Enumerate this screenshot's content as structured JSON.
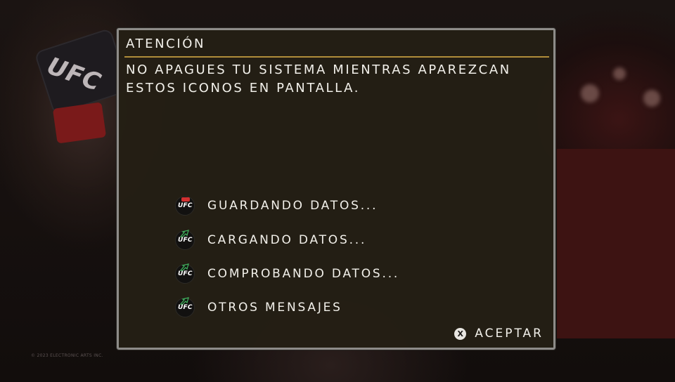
{
  "background": {
    "logo_text": "UFC",
    "copyright": "© 2023 ELECTRONIC ARTS INC."
  },
  "dialog": {
    "title": "ATENCIÓN",
    "message": "NO APAGUES TU SISTEMA MIENTRAS APAREZCAN ESTOS ICONOS EN PANTALLA.",
    "icons": [
      {
        "icon": "ufc-saving-icon",
        "badge_text": "UFC",
        "label": "GUARDANDO DATOS..."
      },
      {
        "icon": "ufc-loading-icon",
        "badge_text": "UFC",
        "label": "CARGANDO DATOS..."
      },
      {
        "icon": "ufc-checking-icon",
        "badge_text": "UFC",
        "label": "COMPROBANDO DATOS..."
      },
      {
        "icon": "ufc-other-icon",
        "badge_text": "UFC",
        "label": "OTROS MENSAJES"
      }
    ],
    "accept": {
      "button_glyph": "X",
      "label": "ACEPTAR"
    }
  },
  "colors": {
    "accent_rule": "#b08d3a",
    "panel": "#241f15",
    "saving_red": "#d13030",
    "loading_green": "#3fae5a"
  }
}
